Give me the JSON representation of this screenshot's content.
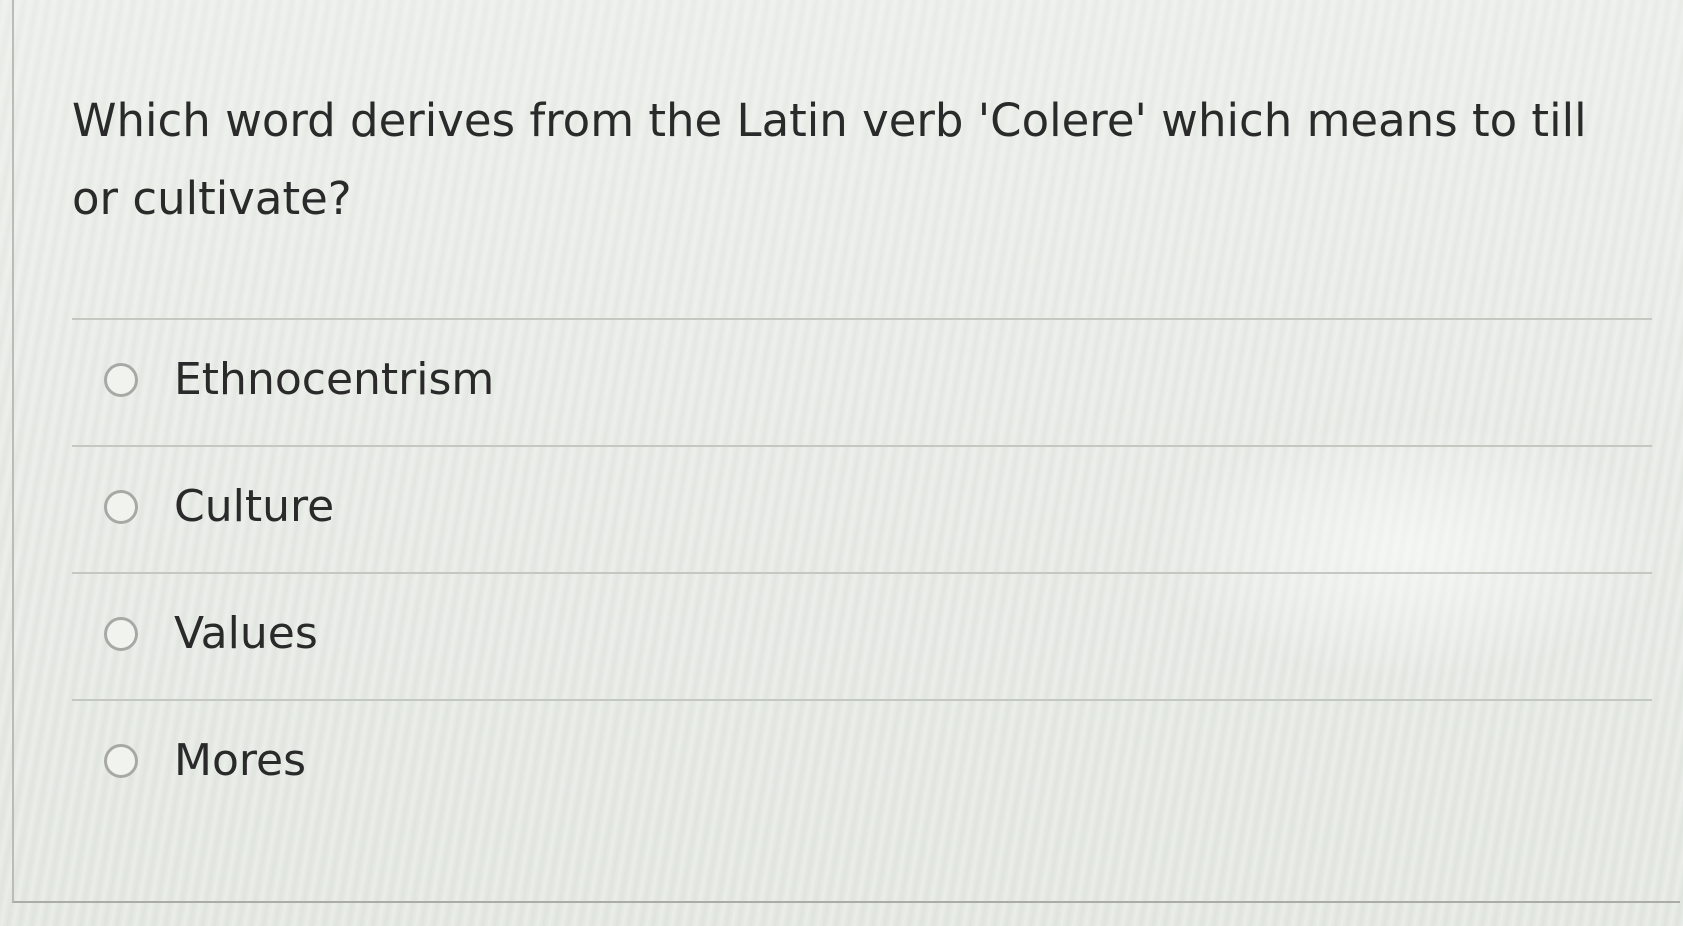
{
  "question": {
    "text": "Which word derives from the Latin verb 'Colere' which means to till or cultivate?"
  },
  "answers": [
    {
      "label": "Ethnocentrism",
      "selected": false
    },
    {
      "label": "Culture",
      "selected": false
    },
    {
      "label": "Values",
      "selected": false
    },
    {
      "label": "Mores",
      "selected": false
    }
  ],
  "colors": {
    "background": "#dde2db",
    "text": "#2a2a2a",
    "divider": "#c3c8c0",
    "radio_border": "#a7aaa4"
  }
}
